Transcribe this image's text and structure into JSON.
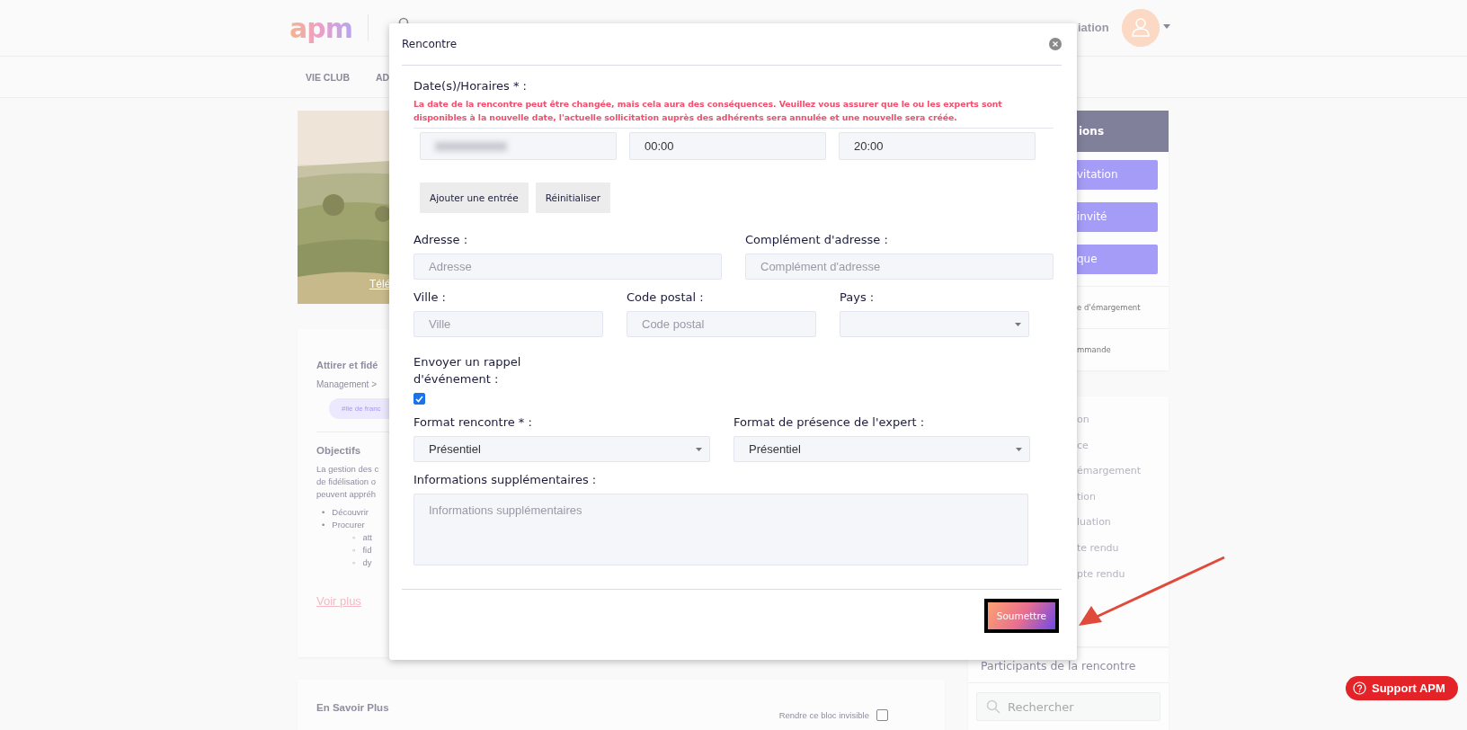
{
  "header": {
    "logo": "apm",
    "user_menu_text": "iation"
  },
  "nav": {
    "items": [
      "VIE CLUB",
      "AD"
    ]
  },
  "event_card": {
    "picture_link": "Télé",
    "title": "Attirer et fidé",
    "breadcrumb": "Management >",
    "tag": "#ile de franc",
    "section_title": "Objectifs",
    "paragraph": [
      "La gestion des c",
      "de fidélisation o",
      "peuvent appréh"
    ],
    "bullets": [
      {
        "marker": "•",
        "text": "Découvrir"
      },
      {
        "marker": "•",
        "text": "Procurer",
        "children": [
          {
            "marker": "◦",
            "text": "att"
          },
          {
            "marker": "◦",
            "text": "fid"
          },
          {
            "marker": "◦",
            "text": "dy"
          }
        ]
      }
    ],
    "more_link": "Voir plus"
  },
  "more_card": {
    "title": "En Savoir Plus",
    "invisible_label": "Rendre ce bloc invisible",
    "invisible_checked": false
  },
  "actions_card": {
    "title": "ions",
    "buttons": [
      "vitation",
      "invité",
      "que"
    ],
    "links": [
      "e d'émargement",
      "mmande"
    ]
  },
  "faded_card": {
    "items": [
      "on",
      "ce",
      "émargement",
      "tion",
      "luation",
      "te rendu",
      "pte rendu"
    ]
  },
  "participants_card": {
    "title": "Participants de la rencontre",
    "search_placeholder": "Rechercher"
  },
  "support_button": "Support APM",
  "modal": {
    "title": "Rencontre",
    "dates_label": "Date(s)/Horaires * :",
    "warning": "La date de la rencontre peut être changée, mais cela aura des conséquences. Veuillez vous assurer que le ou les experts sont disponibles à la nouvelle date, l'actuelle sollicitation auprès des adhérents sera annulée et une nouvelle sera créée.",
    "date_row": {
      "date_blurred": true,
      "start": "00:00",
      "end": "20:00"
    },
    "date_buttons": [
      "Ajouter une entrée",
      "Réinitialiser"
    ],
    "address_fields": [
      {
        "label": "Adresse :",
        "placeholder": "Adresse",
        "kind": "input"
      },
      {
        "label": "Complément d'adresse :",
        "placeholder": "Complément d'adresse",
        "kind": "input"
      }
    ],
    "location_fields": [
      {
        "label": "Ville :",
        "placeholder": "Ville",
        "kind": "input"
      },
      {
        "label": "Code postal :",
        "placeholder": "Code postal",
        "kind": "input"
      },
      {
        "label": "Pays :",
        "kind": "select"
      }
    ],
    "reminder": {
      "label": "Envoyer un rappel d'événement :",
      "checked": true
    },
    "format_fields": [
      {
        "label": "Format rencontre * :",
        "value": "Présentiel",
        "kind": "select"
      },
      {
        "label": "Format de présence de l'expert :",
        "value": "Présentiel",
        "kind": "select"
      }
    ],
    "info": {
      "label": "Informations supplémentaires :",
      "placeholder": "Informations supplémentaires"
    },
    "submit": {
      "label": "Soumettre",
      "highlighted": true
    }
  },
  "annotations": [
    {
      "kind": "arrow"
    }
  ]
}
